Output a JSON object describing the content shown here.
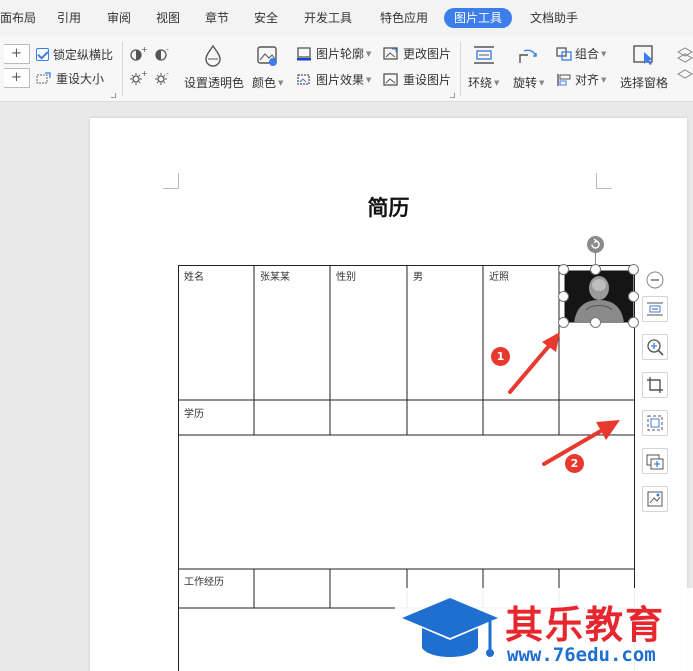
{
  "menu": {
    "items": [
      "面布局",
      "引用",
      "审阅",
      "视图",
      "章节",
      "安全",
      "开发工具",
      "特色应用",
      "图片工具",
      "文档助手"
    ],
    "active_index": 8
  },
  "ribbon": {
    "lock_ratio_label": "锁定纵横比",
    "lock_ratio_checked": true,
    "reset_size_label": "重设大小",
    "stepper_plus": "+",
    "set_transparent_label": "设置透明色",
    "color_label": "颜色",
    "picture_outline_label": "图片轮廓",
    "picture_effects_label": "图片效果",
    "change_picture_label": "更改图片",
    "reset_picture_label": "重设图片",
    "wrap_label": "环绕",
    "rotate_label": "旋转",
    "group_label": "组合",
    "align_label": "对齐",
    "selection_pane_label": "选择窗格"
  },
  "document": {
    "title": "简历",
    "table": {
      "row1": [
        "姓名",
        "张某某",
        "性别",
        "男",
        "近照"
      ],
      "education_label": "学历",
      "work_label": "工作经历"
    }
  },
  "annotations": [
    "1",
    "2"
  ],
  "watermark": {
    "brand": "其乐教育",
    "url": "www.76edu.com"
  },
  "colors": {
    "accent": "#3d7eea",
    "annotation_red": "#e8392f",
    "watermark_blue": "#1f6fd0",
    "watermark_red": "#e8262e"
  }
}
